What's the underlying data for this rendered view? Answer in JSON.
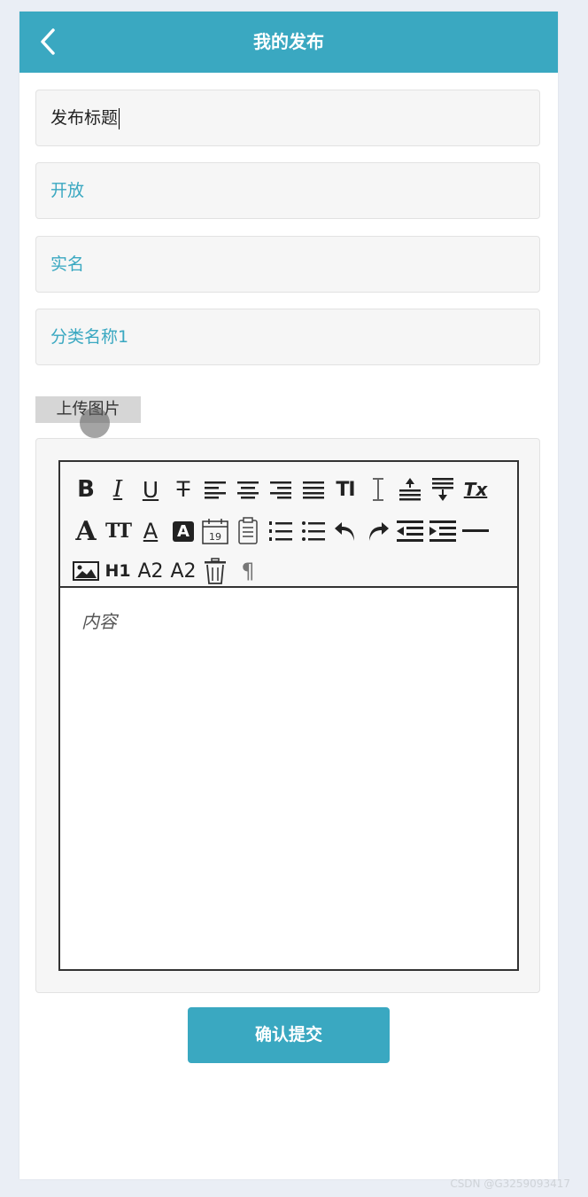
{
  "header": {
    "title": "我的发布",
    "back_icon": "chevron-left-icon"
  },
  "form": {
    "title_value": "发布标题",
    "open_value": "开放",
    "realname_value": "实名",
    "category_value": "分类名称1",
    "upload_label": "上传图片"
  },
  "editor": {
    "placeholder": "内容",
    "toolbar": {
      "bold_glyph": "B",
      "italic_glyph": "I",
      "underline_glyph": "U",
      "strike_glyph": "T",
      "fontsize_glyph": "TI",
      "format_clear_glyph": "Tx",
      "font_glyph": "A",
      "font_small_glyph": "TT",
      "font_color_glyph": "A",
      "bg_color_glyph": "A",
      "date_glyph": "19",
      "h1_glyph": "H1",
      "sub_glyph": "A2",
      "sup_glyph": "A2",
      "paragraph_glyph": "¶"
    }
  },
  "submit_label": "确认提交",
  "watermark": "CSDN @G3259093417",
  "colors": {
    "accent": "#3aa8c1",
    "page_bg": "#eaeef5",
    "field_bg": "#f6f6f6"
  }
}
